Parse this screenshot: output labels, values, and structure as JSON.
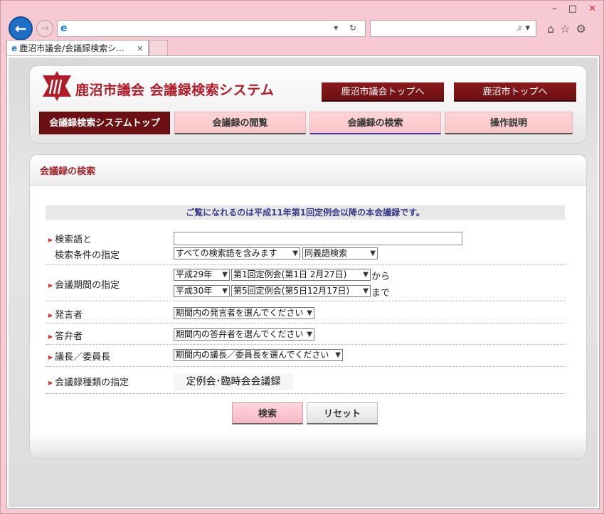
{
  "browser": {
    "window_controls": {
      "minimize": "–",
      "maximize": "□",
      "close": "✕"
    },
    "address_tools": "▾ ↻",
    "search_icon": "⌕ ▾",
    "tab": {
      "title": "鹿沼市議会/会議録検索シ...",
      "close": "×"
    },
    "icons": [
      "home-icon",
      "star-icon",
      "gear-icon"
    ]
  },
  "site": {
    "title": "鹿沼市議会 会議録検索システム",
    "top_links": [
      "鹿沼市議会トップへ",
      "鹿沼市トップへ"
    ],
    "menu": [
      {
        "label": "会議録検索システムトップ",
        "active": true
      },
      {
        "label": "会議録の閲覧",
        "active": false
      },
      {
        "label": "会議録の検索",
        "active": false
      },
      {
        "label": "操作説明",
        "active": false
      }
    ]
  },
  "colors": {
    "brand": "#b21b28",
    "dark_button": "#6d1014",
    "pink_button": "#f8c6c8"
  },
  "search": {
    "panel_title": "会議録の検索",
    "notice": "ご覧になれるのは平成11年第1回定例会以降の本会議録です。",
    "keyword": {
      "label1": "検索語と",
      "label2": "検索条件の指定",
      "value": "",
      "condition": "すべての検索語を含みます",
      "synonym": "同義語検索"
    },
    "period": {
      "label": "会議期間の指定",
      "from_year": "平成29年",
      "from_session": "第1回定例会(第1日 2月27日)",
      "from_suffix": "から",
      "to_year": "平成30年",
      "to_session": "第5回定例会(第5日12月17日)",
      "to_suffix": "まで"
    },
    "speaker": {
      "label": "発言者",
      "value": "期間内の発言者を選んでください"
    },
    "respondent": {
      "label": "答弁者",
      "value": "期間内の答弁者を選んでください"
    },
    "chair": {
      "label": "議長／委員長",
      "value": "期間内の議長／委員長を選んでください"
    },
    "type": {
      "label": "会議録種類の指定",
      "value": "定例会･臨時会会議録"
    },
    "buttons": {
      "search": "検索",
      "reset": "リセット"
    }
  }
}
